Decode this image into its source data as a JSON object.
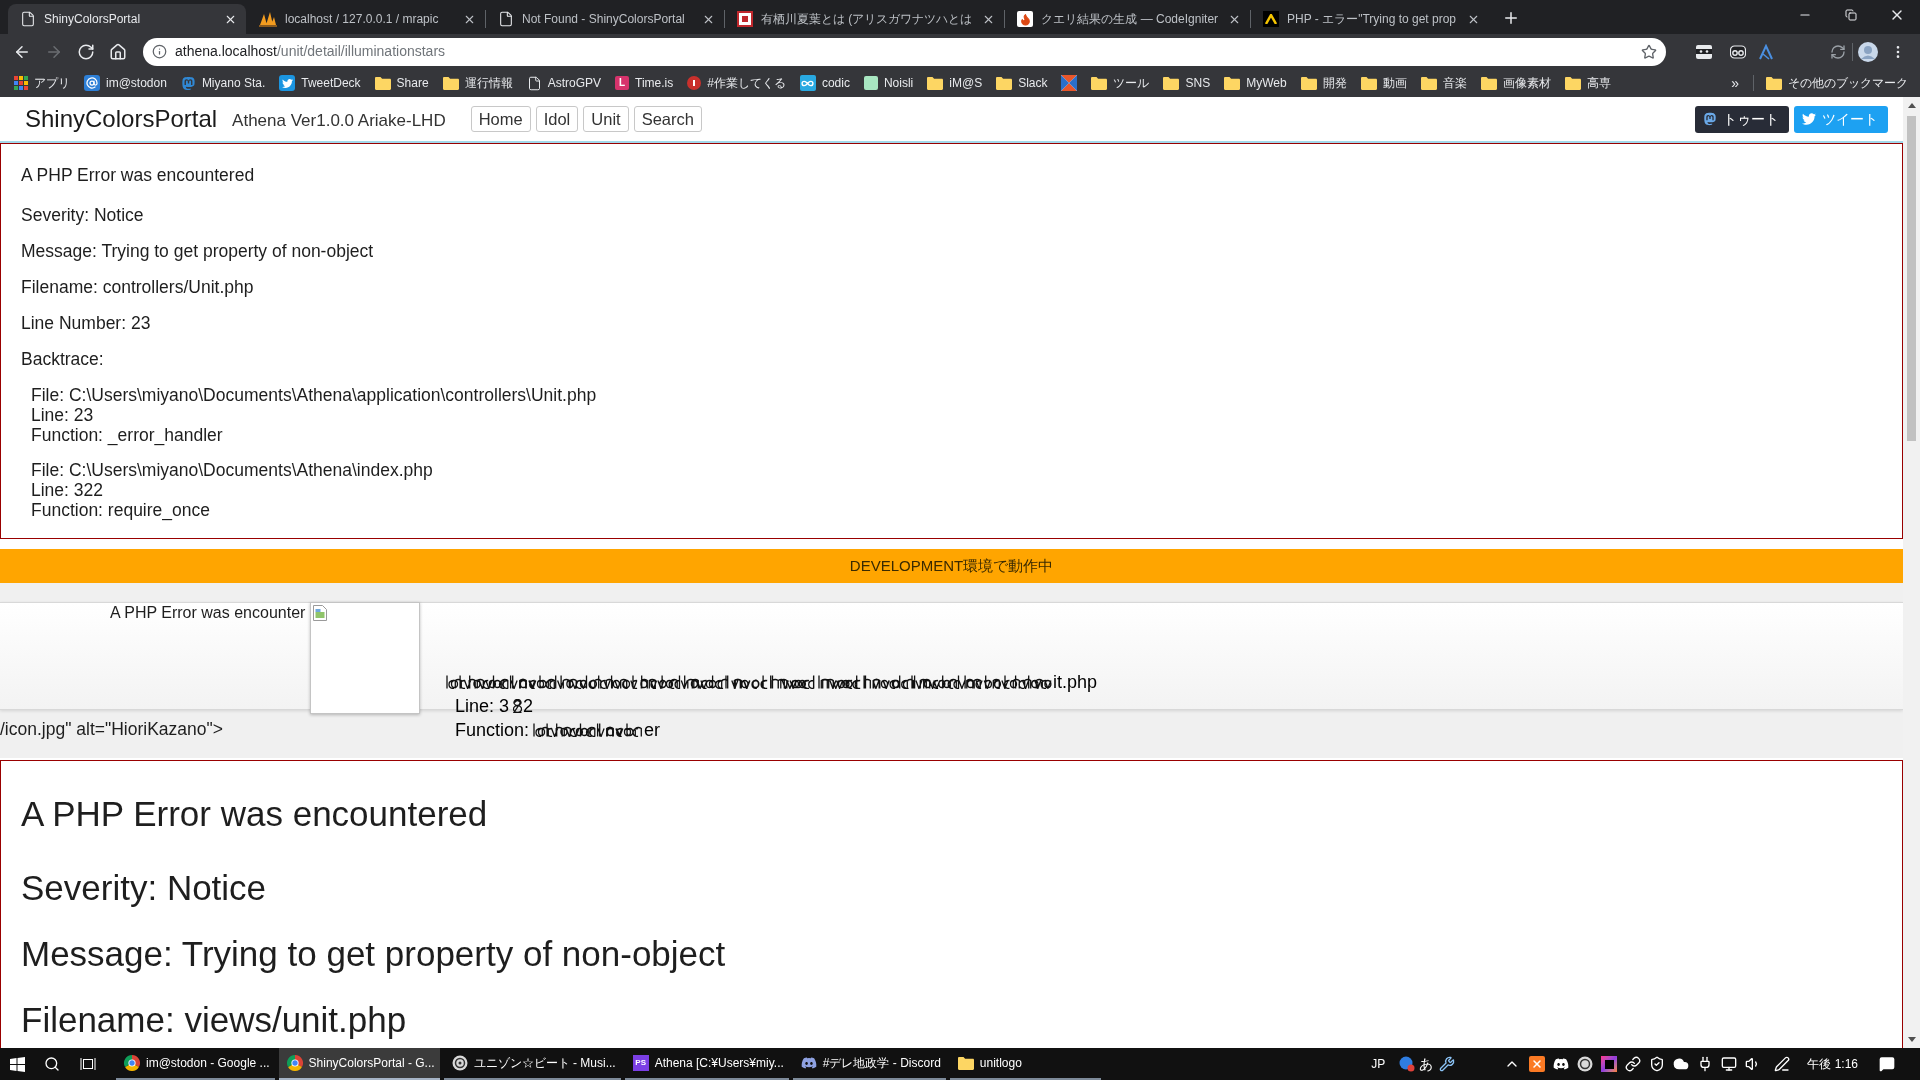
{
  "browser": {
    "tabs": [
      {
        "title": "ShinyColorsPortal",
        "kind": "page",
        "selected": true
      },
      {
        "title": "localhost / 127.0.0.1 / mrapic",
        "kind": "sails",
        "selected": false
      },
      {
        "title": "Not Found - ShinyColorsPortal",
        "kind": "page",
        "selected": false
      },
      {
        "title": "有栖川夏葉とは (アリスガワナツハとは",
        "kind": "frame",
        "selected": false
      },
      {
        "title": "クエリ結果の生成 — CodeIgniter",
        "kind": "flame",
        "selected": false
      },
      {
        "title": "PHP - エラー\"Trying to get prop",
        "kind": "chevron",
        "selected": false
      }
    ],
    "nav_buttons": [
      {
        "kind": "back",
        "disabled": false
      },
      {
        "kind": "forward",
        "disabled": true
      },
      {
        "kind": "reload",
        "disabled": false
      },
      {
        "kind": "home",
        "disabled": false
      }
    ],
    "address": {
      "host": "athena.localhost",
      "path": "/unit/detail/illuminationstars"
    },
    "bookmarks": [
      {
        "label": "アプリ",
        "kind": "apps"
      },
      {
        "label": "im@stodon",
        "kind": "at"
      },
      {
        "label": "Miyano Sta.",
        "kind": "bubble"
      },
      {
        "label": "TweetDeck",
        "kind": "bird"
      },
      {
        "label": "Share",
        "kind": "folder"
      },
      {
        "label": "運行情報",
        "kind": "folder"
      },
      {
        "label": "AstroGPV",
        "kind": "page"
      },
      {
        "label": "Time.is",
        "kind": "letter",
        "badge": "L"
      },
      {
        "label": "#作業してくる",
        "kind": "dot"
      },
      {
        "label": "codic",
        "kind": "infinity"
      },
      {
        "label": "Noisli",
        "kind": "tile"
      },
      {
        "label": "iM@S",
        "kind": "folder"
      },
      {
        "label": "Slack",
        "kind": "folder"
      },
      {
        "kind": "pinwheel"
      },
      {
        "label": "ツール",
        "kind": "folder"
      },
      {
        "label": "SNS",
        "kind": "folder"
      },
      {
        "label": "MyWeb",
        "kind": "folder"
      },
      {
        "label": "開発",
        "kind": "folder"
      },
      {
        "label": "動画",
        "kind": "folder"
      },
      {
        "label": "音楽",
        "kind": "folder"
      },
      {
        "label": "画像素材",
        "kind": "folder"
      },
      {
        "label": "高専",
        "kind": "folder"
      }
    ],
    "bookmarks_overflow": "»",
    "other_bookmarks": "その他のブックマーク"
  },
  "page": {
    "navbar": {
      "brand": "ShinyColorsPortal",
      "version": "Athena Ver1.0.0 Ariake-LHD",
      "links": [
        "Home",
        "Idol",
        "Unit",
        "Search"
      ],
      "share_buttons": [
        {
          "label": "トゥート",
          "kind": "toot"
        },
        {
          "label": "ツイート",
          "kind": "tweet"
        }
      ]
    },
    "error_notice": {
      "heading": "A PHP Error was encountered",
      "lines": [
        "Severity: Notice",
        "Message: Trying to get property of non-object",
        "Filename: controllers/Unit.php",
        "Line Number: 23",
        "Backtrace:"
      ],
      "backtrace": [
        {
          "file": "File: C:\\Users\\miyano\\Documents\\Athena\\application\\controllers\\Unit.php",
          "line": "Line: 23",
          "function": "Function: _error_handler"
        },
        {
          "file": "File: C:\\Users\\miyano\\Documents\\Athena\\index.php",
          "line": "Line: 322",
          "function": "Function: require_once"
        }
      ]
    },
    "environment_banner": "DEVELOPMENT環境で動作中",
    "broken_block": {
      "heading": "A PHP Error was encounter",
      "overprinted_rows": [
        {
          "tail": "it.php"
        },
        {
          "lead": "Line: 3",
          "tail": "2"
        },
        {
          "lead": "Function:",
          "tail": "er"
        }
      ],
      "stray_markup": "/icon.jpg\" alt=\"HioriKazano\">"
    },
    "error_notice_large": {
      "heading": "A PHP Error was encountered",
      "lines": [
        "Severity: Notice",
        "Message: Trying to get property of non-object",
        "Filename: views/unit.php"
      ]
    }
  },
  "taskbar": {
    "apps": [
      {
        "label": "im@stodon - Google ...",
        "kind": "browser",
        "selected": false
      },
      {
        "label": "ShinyColorsPortal - G...",
        "kind": "browser",
        "selected": true
      },
      {
        "label": "ユニゾン☆ビート - Musi...",
        "kind": "player",
        "selected": false
      },
      {
        "label": "Athena [C:¥Users¥miy...",
        "kind": "ide",
        "badge": "PS",
        "selected": false
      },
      {
        "label": "#デレ地政学 - Discord",
        "kind": "chat",
        "selected": false
      },
      {
        "label": "unitlogo",
        "kind": "folder",
        "selected": false
      }
    ],
    "input_language": "JP",
    "ime_mode": "あ",
    "clock": "午後 1:16"
  }
}
